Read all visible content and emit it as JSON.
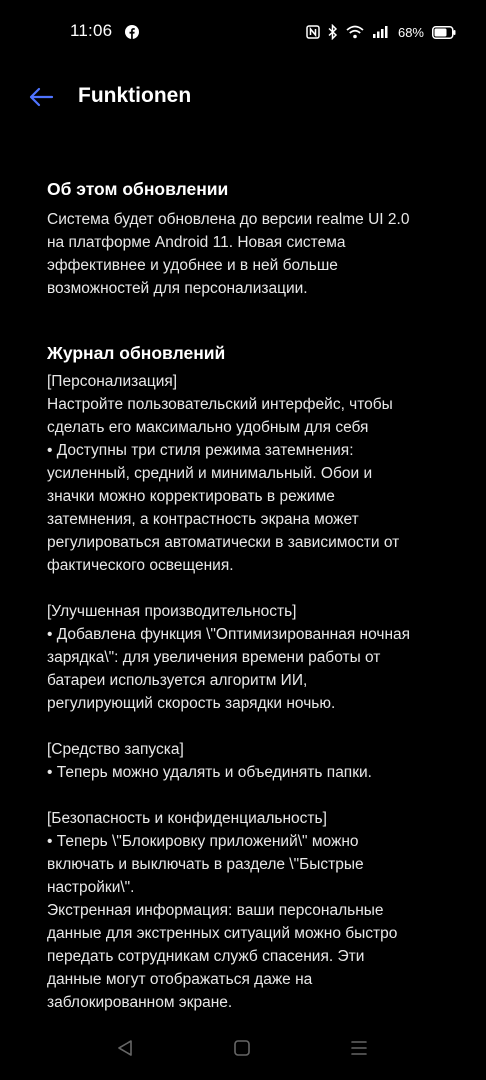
{
  "status_bar": {
    "time": "11:06",
    "battery": "68%"
  },
  "app_bar": {
    "title": "Funktionen"
  },
  "about": {
    "title": "Об этом обновлении",
    "body": "Система будет обновлена до версии realme UI 2.0\nна платформе Android 11. Новая система\nэффективнее и удобнее и в ней больше\nвозможностей для персонализации."
  },
  "changelog": {
    "title": "Журнал обновлений",
    "body": "[Персонализация]\nНастройте пользовательский интерфейс, чтобы\nсделать его максимально удобным для себя\n• Доступны три стиля режима затемнения:\nусиленный, средний и минимальный. Обои и\nзначки можно корректировать в режиме\nзатемнения, а контрастность экрана может\nрегулироваться автоматически в зависимости от\nфактического освещения.\n\n[Улучшенная производительность]\n• Добавлена функция \\\"Оптимизированная ночная\nзарядка\\\": для увеличения времени работы от\nбатареи используется алгоритм ИИ,\nрегулирующий скорость зарядки ночью.\n\n[Средство запуска]\n• Теперь можно удалять и объединять папки.\n\n[Безопасность и конфиденциальность]\n• Теперь \\\"Блокировку приложений\\\" можно\nвключать и выключать в разделе \\\"Быстрые\nнастройки\\\".\nЭкстренная информация: ваши персональные\nданные для экстренных ситуаций можно быстро\nпередать сотрудникам служб спасения. Эти\nданные могут отображаться даже на\nзаблокированном экране."
  },
  "colors": {
    "background": "#000000",
    "accent": "#4f74ff",
    "text": "#ffffff"
  },
  "icons": {
    "back": "arrow-left-icon",
    "facebook": "facebook-icon",
    "nfc": "nfc-icon",
    "bluetooth": "bluetooth-icon",
    "wifi": "wifi-icon",
    "signal": "signal-icon",
    "battery": "battery-icon",
    "nav_back": "nav-back-triangle-icon",
    "nav_home": "nav-home-square-icon",
    "nav_recent": "nav-recents-lines-icon"
  }
}
